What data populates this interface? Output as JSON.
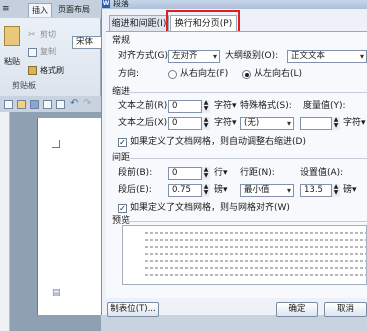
{
  "app": {
    "ribbon_tabs": [
      "插入",
      "页面布局"
    ],
    "font_partial": "宋体",
    "clipboard": {
      "paste": "粘贴",
      "cut": "剪切",
      "copy": "复制",
      "format_painter": "格式刷",
      "group": "剪贴板"
    },
    "logo_letter": "W"
  },
  "dialog": {
    "title": "段落",
    "tabs": [
      "缩进和间距(I)",
      "换行和分页(P)"
    ],
    "general": {
      "section": "常规",
      "alignment_label": "对齐方式(G):",
      "alignment_value": "左对齐",
      "outline_label": "大纲级别(O):",
      "outline_value": "正文文本",
      "direction_label": "方向:",
      "rtl": "从右向左(F)",
      "ltr": "从左向右(L)"
    },
    "indent": {
      "section": "缩进",
      "before_label": "文本之前(R):",
      "before_value": "0",
      "before_unit": "字符▾",
      "special_label": "特殊格式(S):",
      "special_value": "(无)",
      "measure_label": "度量值(Y):",
      "measure_unit": "字符▾",
      "after_label": "文本之后(X):",
      "after_value": "0",
      "after_unit": "字符▾",
      "grid_check": "如果定义了文档网格，则自动调整右缩进(D)"
    },
    "spacing": {
      "section": "间距",
      "before_label": "段前(B):",
      "before_value": "0",
      "before_unit": "行▾",
      "line_label": "行距(N):",
      "line_value": "最小值",
      "setting_label": "设置值(A):",
      "setting_value": "13.5",
      "setting_unit": "磅▾",
      "after_label": "段后(E):",
      "after_value": "0.75",
      "after_unit": "磅▾",
      "grid_check": "如果定义了文档网格，则与网格对齐(W)"
    },
    "preview_label": "预览",
    "buttons": {
      "tabs": "制表位(T)...",
      "ok": "确定",
      "cancel": "取消"
    }
  }
}
